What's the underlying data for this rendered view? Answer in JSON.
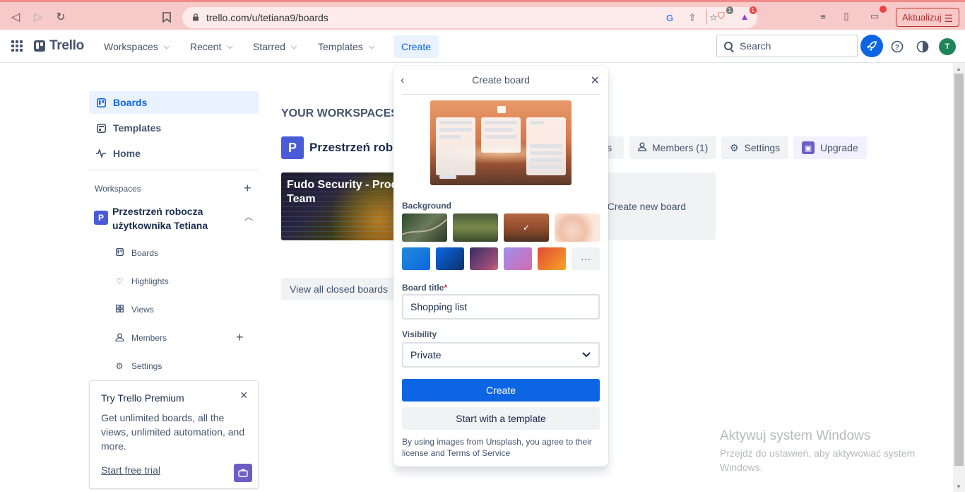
{
  "browser": {
    "url": "trello.com/u/tetiana9/boards",
    "update_label": "Aktualizuj",
    "brave_badge": "1",
    "rewards_badge": "1"
  },
  "header": {
    "logo": "Trello",
    "nav": [
      "Workspaces",
      "Recent",
      "Starred",
      "Templates"
    ],
    "create_label": "Create",
    "search_placeholder": "Search",
    "avatar_initial": "T"
  },
  "sidebar": {
    "items": [
      {
        "label": "Boards",
        "icon": "board-icon"
      },
      {
        "label": "Templates",
        "icon": "template-icon"
      },
      {
        "label": "Home",
        "icon": "pulse-icon"
      }
    ],
    "workspaces_label": "Workspaces",
    "workspace": {
      "badge": "P",
      "name": "Przestrzeń robocza użytkownika Tetiana"
    },
    "sub_items": [
      "Boards",
      "Highlights",
      "Views",
      "Members",
      "Settings"
    ],
    "premium": {
      "title": "Try Trello Premium",
      "body": "Get unlimited boards, all the views, unlimited automation, and more.",
      "cta": "Start free trial"
    }
  },
  "main": {
    "section_title": "YOUR WORKSPACES",
    "workspace_name": "Przestrzeń robo",
    "workspace_badge": "P",
    "buttons": {
      "views_partial": "ws",
      "members": "Members (1)",
      "settings": "Settings",
      "upgrade": "Upgrade"
    },
    "board_tile": "Fudo Security - Prod Team",
    "create_new_board": "Create new board",
    "closed_boards": "View all closed boards"
  },
  "popover": {
    "title": "Create board",
    "background_label": "Background",
    "board_title_label": "Board title",
    "required_mark": "*",
    "board_title_value": "Shopping list",
    "visibility_label": "Visibility",
    "visibility_value": "Private",
    "create_button": "Create",
    "template_button": "Start with a template",
    "legal": "By using images from Unsplash, you agree to their license and Terms of Service",
    "more_label": "···",
    "colors": [
      "#0c66e4",
      "#09326c",
      "#6e5dc6",
      "#a259ff",
      "#f87168"
    ]
  },
  "watermark": {
    "title": "Aktywuj system Windows",
    "subtitle": "Przejdź do ustawień, aby aktywować system Windows."
  }
}
